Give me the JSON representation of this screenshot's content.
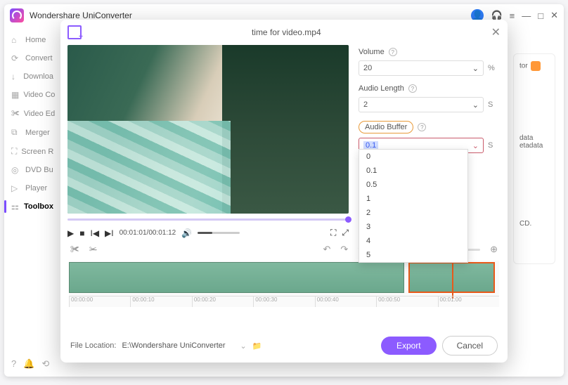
{
  "app": {
    "title": "Wondershare UniConverter"
  },
  "sidebar": {
    "items": [
      {
        "icon": "⌂",
        "label": "Home"
      },
      {
        "icon": "⟳",
        "label": "Convert"
      },
      {
        "icon": "↓",
        "label": "Downloa"
      },
      {
        "icon": "▦",
        "label": "Video Co"
      },
      {
        "icon": "✀",
        "label": "Video Ed"
      },
      {
        "icon": "⧉",
        "label": "Merger"
      },
      {
        "icon": "⛶",
        "label": "Screen R"
      },
      {
        "icon": "◎",
        "label": "DVD Bu"
      },
      {
        "icon": "▷",
        "label": "Player"
      },
      {
        "icon": "⚏",
        "label": "Toolbox"
      }
    ]
  },
  "bg_card": {
    "tor": "tor",
    "data": "data",
    "etadata": "etadata",
    "cd": "CD."
  },
  "modal": {
    "title": "time for video.mp4",
    "time": "00:01:01/00:01:12",
    "settings": {
      "volume": {
        "label": "Volume",
        "value": "20",
        "unit": "%"
      },
      "audio_length": {
        "label": "Audio Length",
        "value": "2",
        "unit": "S"
      },
      "audio_buffer": {
        "label": "Audio Buffer",
        "value": "0.1",
        "unit": "S",
        "options": [
          "0",
          "0.1",
          "0.5",
          "1",
          "2",
          "3",
          "4",
          "5"
        ]
      }
    },
    "ruler": [
      "00:00:00",
      "00:00:10",
      "00:00:20",
      "00:00:30",
      "00:00:40",
      "00:00:50",
      "00:01:00"
    ],
    "footer": {
      "location_label": "File Location:",
      "path": "E:\\Wondershare UniConverter",
      "export": "Export",
      "cancel": "Cancel"
    }
  }
}
